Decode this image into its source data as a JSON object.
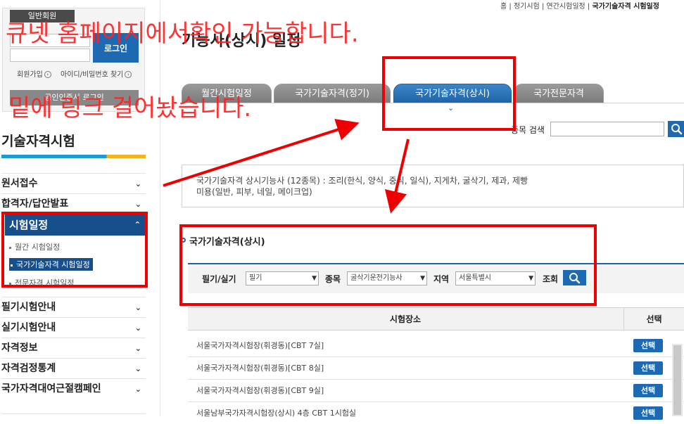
{
  "annotations": {
    "line1": "큐넷 홈페이지에서확인 가능합니다.",
    "line2": "밑에 링크 걸어놨습니다."
  },
  "login": {
    "tag": "일반회원",
    "login_button": "로그인",
    "signup": "회원가입",
    "find_account": "아이디/비밀번호 찾기",
    "cert_button": "공인인증서 로그인"
  },
  "sidebar": {
    "title": "기술자격시험",
    "items": [
      {
        "label": "원서접수",
        "chev": "⌄"
      },
      {
        "label": "합격자/답안발표",
        "chev": "⌄"
      },
      {
        "label": "시험일정",
        "chev": "⌃"
      },
      {
        "label": "필기시험안내",
        "chev": "⌄"
      },
      {
        "label": "실기시험안내",
        "chev": "⌄"
      },
      {
        "label": "자격정보",
        "chev": "⌄"
      },
      {
        "label": "자격검정통계",
        "chev": "⌄"
      },
      {
        "label": "국가자격대여근절캠페인",
        "chev": "⌄"
      }
    ],
    "sub_items": [
      "월간 시험일정",
      "국가기술자격 시험일정",
      "전문자격 시험일정"
    ]
  },
  "breadcrumb": {
    "home": "홈",
    "sep": "|",
    "c1": "정기시험",
    "c2": "연간시험일정",
    "current": "국가기술자격 시험일정"
  },
  "page_title": "기능사(상시) 일정",
  "tabs": [
    {
      "label": "월간시험일정",
      "active": false
    },
    {
      "label": "국가기술자격(정기)",
      "active": false
    },
    {
      "label": "국가기술자격(상시)",
      "active": true
    },
    {
      "label": "국가전문자격",
      "active": false
    }
  ],
  "search": {
    "label": "종목 검색",
    "value": ""
  },
  "description": {
    "line1": "국가기술자격 상시기능사 (12종목) : 조리(한식, 양식, 중식, 일식), 지게차, 굴삭기, 제과, 제빵",
    "line2": "미용(일반, 피부, 네일, 메이크업)"
  },
  "section_title": "국가기술자격(상시)",
  "filters": {
    "type_label": "필기/실기",
    "type_value": "필기",
    "item_label": "종목",
    "item_value": "굴삭기운전기능사",
    "region_label": "지역",
    "region_value": "서울특별시",
    "search_label": "조회"
  },
  "table": {
    "headers": [
      "시험장소",
      "선택"
    ],
    "rows": [
      {
        "venue": "서울국가자격시험장(휘경동)[CBT 7실]",
        "action": "선택"
      },
      {
        "venue": "서울국가자격시험장(휘경동)[CBT 8실]",
        "action": "선택"
      },
      {
        "venue": "서울국가자격시험장(휘경동)[CBT 9실]",
        "action": "선택"
      },
      {
        "venue": "서울남부국가자격시험장(상시) 4층 CBT 1시험실",
        "action": "선택"
      }
    ]
  },
  "colors": {
    "accent_blue": "#1d6ab3",
    "active_nav": "#174f8c",
    "annotation_red": "#ff2222"
  }
}
